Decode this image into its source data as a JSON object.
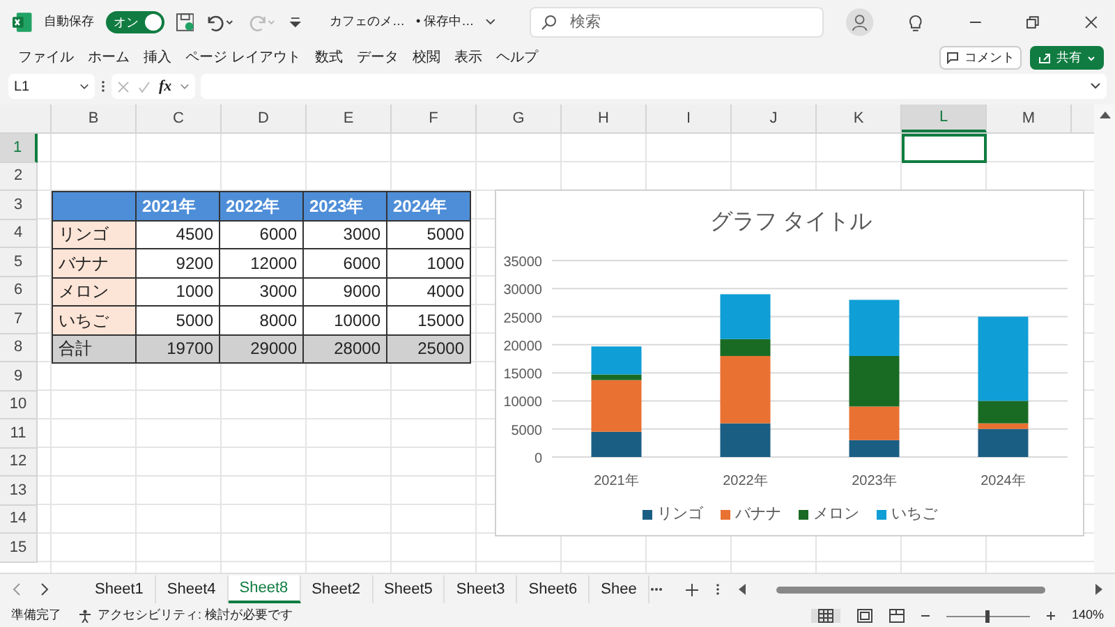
{
  "title_bar": {
    "autosave_label": "自動保存",
    "autosave_toggle": {
      "label": "オン",
      "on": true
    },
    "file_name": "カフェのメ…",
    "save_status": "• 保存中…",
    "search": {
      "placeholder": "検索"
    }
  },
  "menu": [
    "ファイル",
    "ホーム",
    "挿入",
    "ページ レイアウト",
    "数式",
    "データ",
    "校閲",
    "表示",
    "ヘルプ"
  ],
  "comment_button": "コメント",
  "share_button": "共有",
  "formula_bar": {
    "name_box": "L1",
    "fx": "fx"
  },
  "columns": [
    {
      "label": "B",
      "selected": false
    },
    {
      "label": "C",
      "selected": false
    },
    {
      "label": "D",
      "selected": false
    },
    {
      "label": "E",
      "selected": false
    },
    {
      "label": "F",
      "selected": false
    },
    {
      "label": "G",
      "selected": false
    },
    {
      "label": "H",
      "selected": false
    },
    {
      "label": "I",
      "selected": false
    },
    {
      "label": "J",
      "selected": false
    },
    {
      "label": "K",
      "selected": false
    },
    {
      "label": "L",
      "selected": true
    },
    {
      "label": "M",
      "selected": false
    }
  ],
  "rows": [
    {
      "label": "1",
      "selected": true
    },
    {
      "label": "2",
      "selected": false
    },
    {
      "label": "3",
      "selected": false
    },
    {
      "label": "4",
      "selected": false
    },
    {
      "label": "5",
      "selected": false
    },
    {
      "label": "6",
      "selected": false
    },
    {
      "label": "7",
      "selected": false
    },
    {
      "label": "8",
      "selected": false
    },
    {
      "label": "9",
      "selected": false
    },
    {
      "label": "10",
      "selected": false
    },
    {
      "label": "11",
      "selected": false
    },
    {
      "label": "12",
      "selected": false
    },
    {
      "label": "13",
      "selected": false
    },
    {
      "label": "14",
      "selected": false
    },
    {
      "label": "15",
      "selected": false
    }
  ],
  "table": {
    "header": [
      "2021年",
      "2022年",
      "2023年",
      "2024年"
    ],
    "rows": [
      {
        "kind": "item",
        "label": "リンゴ",
        "values": [
          "4500",
          "6000",
          "3000",
          "5000"
        ]
      },
      {
        "kind": "item",
        "label": "バナナ",
        "values": [
          "9200",
          "12000",
          "6000",
          "1000"
        ]
      },
      {
        "kind": "item",
        "label": "メロン",
        "values": [
          "1000",
          "3000",
          "9000",
          "4000"
        ]
      },
      {
        "kind": "item",
        "label": "いちご",
        "values": [
          "5000",
          "8000",
          "10000",
          "15000"
        ]
      },
      {
        "kind": "total",
        "label": "合計",
        "values": [
          "19700",
          "29000",
          "28000",
          "25000"
        ]
      }
    ]
  },
  "chart_data": {
    "type": "bar",
    "title": "グラフ タイトル",
    "stacked": true,
    "grid": true,
    "legend": true,
    "categories": [
      "2021年",
      "2022年",
      "2023年",
      "2024年"
    ],
    "ylim": [
      0,
      35000
    ],
    "yticks": [
      {
        "value": 0,
        "label": "0"
      },
      {
        "value": 5000,
        "label": "5000"
      },
      {
        "value": 10000,
        "label": "10000"
      },
      {
        "value": 15000,
        "label": "15000"
      },
      {
        "value": 20000,
        "label": "20000"
      },
      {
        "value": 25000,
        "label": "25000"
      },
      {
        "value": 30000,
        "label": "30000"
      },
      {
        "value": 35000,
        "label": "35000"
      }
    ],
    "series": [
      {
        "name": "リンゴ",
        "color": "#1b5e84",
        "values": [
          4500,
          6000,
          3000,
          5000
        ]
      },
      {
        "name": "バナナ",
        "color": "#e97132",
        "values": [
          9200,
          12000,
          6000,
          1000
        ]
      },
      {
        "name": "メロン",
        "color": "#196b24",
        "values": [
          1000,
          3000,
          9000,
          4000
        ]
      },
      {
        "name": "いちご",
        "color": "#0f9ed5",
        "values": [
          5000,
          8000,
          10000,
          15000
        ]
      }
    ]
  },
  "sheet_tabs": [
    {
      "label": "Sheet1",
      "selected": false
    },
    {
      "label": "Sheet4",
      "selected": false
    },
    {
      "label": "Sheet8",
      "selected": true
    },
    {
      "label": "Sheet2",
      "selected": false
    },
    {
      "label": "Sheet5",
      "selected": false
    },
    {
      "label": "Sheet3",
      "selected": false
    },
    {
      "label": "Sheet6",
      "selected": false
    },
    {
      "label": "Shee",
      "selected": false
    }
  ],
  "status_bar": {
    "ready": "準備完了",
    "accessibility": "アクセシビリティ: 検討が必要です",
    "zoom": {
      "level": 0.5,
      "reading": "140%"
    }
  }
}
